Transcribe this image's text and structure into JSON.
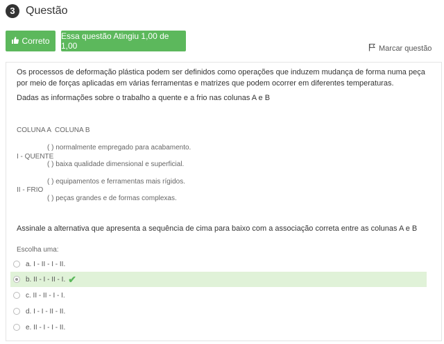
{
  "header": {
    "number": "3",
    "title": "Questão"
  },
  "status": {
    "correct_label": "Correto",
    "grade_label": "Essa questão Atingiu 1,00 de 1,00"
  },
  "flag_label": "Marcar questão",
  "question": {
    "intro": "Os processos de deformação plástica podem ser definidos como operações que induzem mudança de forma numa peça por meio de forças aplicadas em várias ferramentas e matrizes que podem ocorrer em diferentes temperaturas.",
    "given": "Dadas as informações sobre o trabalho a quente e a frio nas colunas A e B",
    "columns_header": "COLUNA A  COLUNA B",
    "col_a": [
      "I - QUENTE",
      "II - FRIO"
    ],
    "col_b": [
      "( ) normalmente empregado para acabamento.",
      "( ) baixa qualidade dimensional e superficial.",
      "( ) equipamentos e ferramentas mais rígidos.",
      "( ) peças grandes e de formas complexas."
    ],
    "prompt": "Assinale a alternativa que apresenta a sequência de cima para baixo com a associação correta entre as colunas A e B",
    "choose_label": "Escolha uma:"
  },
  "options": [
    {
      "label": "a. I - II - I - II.",
      "selected": false
    },
    {
      "label": "b. II - I - II - I.",
      "selected": true
    },
    {
      "label": "c. II - II - I - I.",
      "selected": false
    },
    {
      "label": "d. I - I - II - II.",
      "selected": false
    },
    {
      "label": "e. II - I - I - II.",
      "selected": false
    }
  ],
  "colors": {
    "accent": "#5cb85c",
    "selected_bg": "#e0f2d8"
  }
}
